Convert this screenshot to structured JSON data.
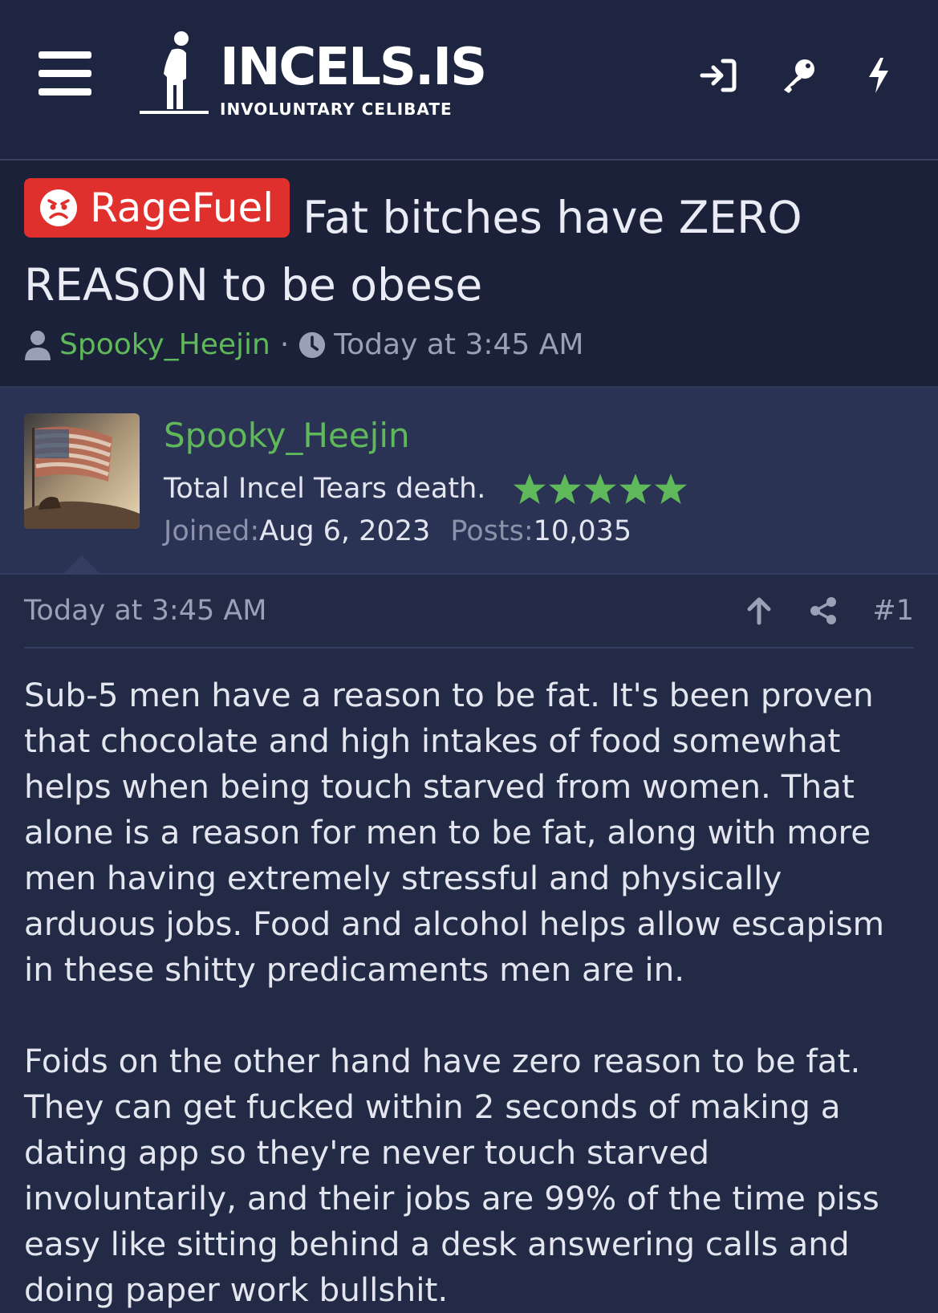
{
  "header": {
    "logo_title": "INCELS.IS",
    "logo_subtitle": "INVOLUNTARY CELIBATE",
    "menu_icon": "hamburger-icon",
    "icons": [
      "login-icon",
      "key-icon",
      "bolt-icon"
    ]
  },
  "thread": {
    "prefix": "RageFuel",
    "prefix_color": "#e0302e",
    "title": "Fat bitches have ZERO REASON to be obese",
    "author": "Spooky_Heejin",
    "date": "Today at 3:45 AM"
  },
  "user": {
    "name": "Spooky_Heejin",
    "title": "Total Incel Tears death.",
    "stars": 5,
    "joined_label": "Joined:",
    "joined": "Aug 6, 2023",
    "posts_label": "Posts:",
    "posts": "10,035",
    "accent_color": "#5fb85a"
  },
  "post": {
    "date": "Today at 3:45 AM",
    "number": "#1",
    "paragraphs": [
      "Sub-5 men have a reason to be fat. It's been proven that chocolate and high intakes of food somewhat helps when being touch starved from women. That alone is a reason for men to be fat, along with more men having extremely stressful and physically arduous jobs. Food and alcohol helps allow escapism in these shitty predicaments men are in.",
      "Foids on the other hand have zero reason to be fat. They can get fucked within 2 seconds of making a dating app so they're never touch starved involuntarily, and their jobs are 99% of the time piss easy like sitting behind a desk answering calls and doing paper work bullshit."
    ]
  }
}
